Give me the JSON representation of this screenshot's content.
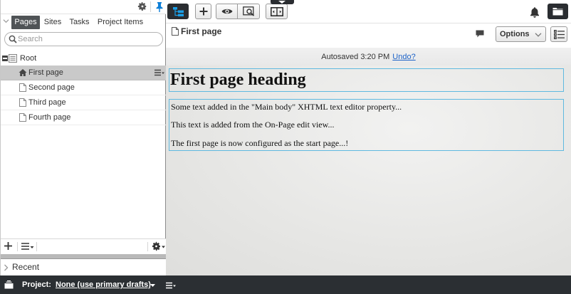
{
  "left_tabs": {
    "pages": "Pages",
    "sites": "Sites",
    "tasks": "Tasks",
    "project_items": "Project Items"
  },
  "search": {
    "placeholder": "Search",
    "value": ""
  },
  "tree": {
    "root": "Root",
    "children": [
      "First page",
      "Second page",
      "Third page",
      "Fourth page"
    ]
  },
  "recent": {
    "label": "Recent"
  },
  "document": {
    "title": "First page",
    "options_label": "Options"
  },
  "autosave": {
    "text": "Autosaved 3:20 PM",
    "undo_label": "Undo?"
  },
  "content": {
    "heading": "First page heading",
    "paragraphs": [
      "Some text added in the \"Main body\" XHTML text editor property...",
      "This text is added from the On-Page edit view...",
      "The first page is now configured as the start page...!"
    ]
  },
  "project_bar": {
    "label": "Project:",
    "value": "None (use primary drafts)"
  },
  "colors": {
    "accent": "#0e7fd8",
    "dark_toolbar": "#2a2d31",
    "selection": "#c9c9c9",
    "edit_outline": "#5fb9e0",
    "link": "#1d63c8"
  },
  "icons": [
    "gear-icon",
    "pin-icon",
    "search-icon",
    "home-icon",
    "page-icon",
    "bell-icon",
    "folder-icon",
    "comment-icon",
    "eye-icon",
    "preview-icon",
    "compare-icon",
    "tree-icon",
    "plus-icon"
  ]
}
